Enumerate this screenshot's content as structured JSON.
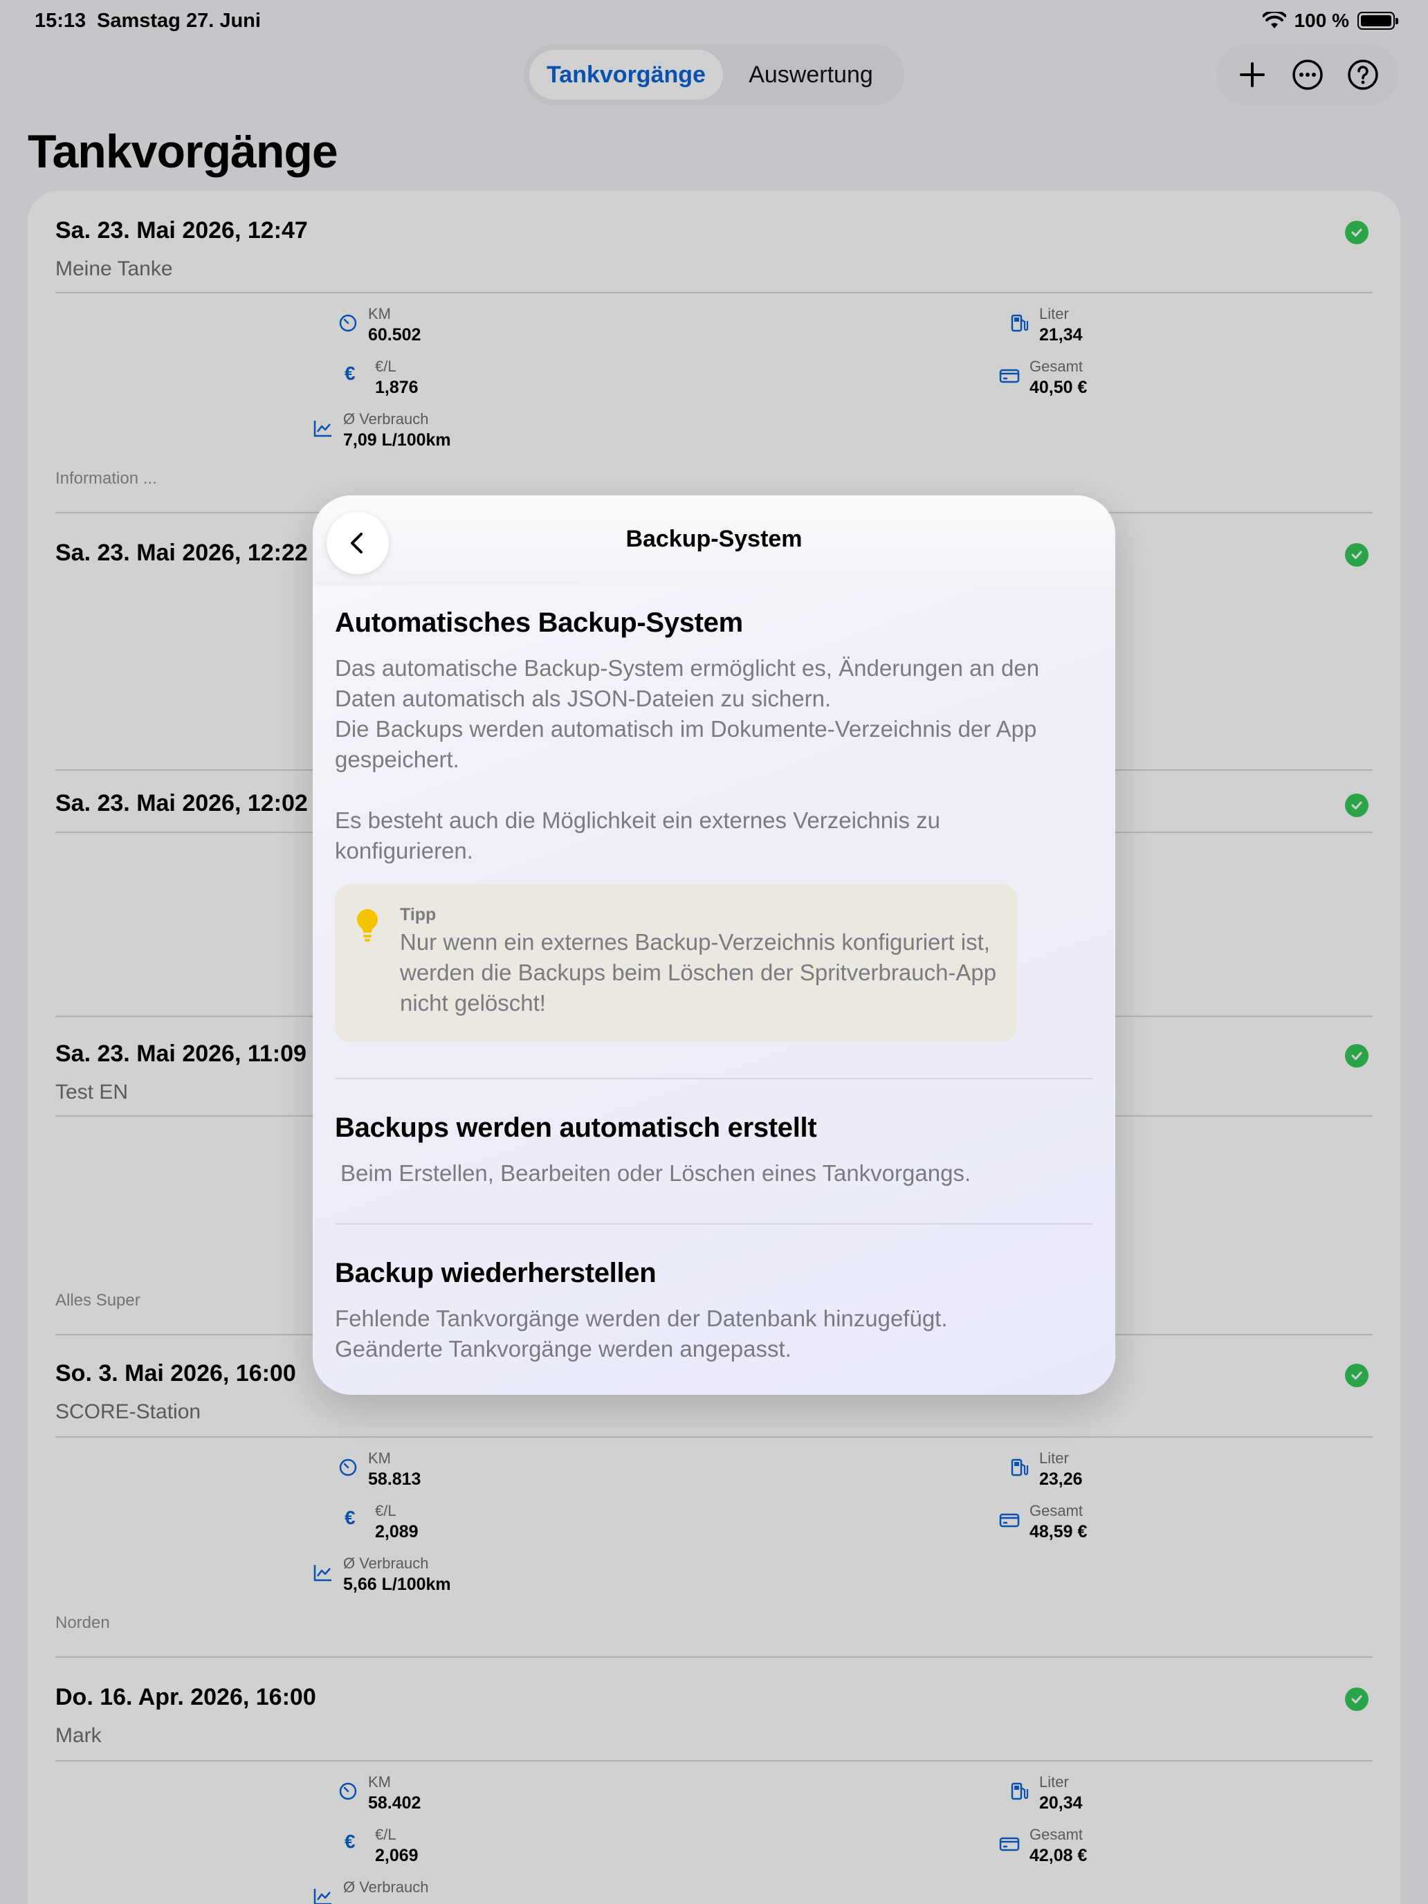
{
  "status_bar": {
    "time": "15:13",
    "date": "Samstag 27. Juni",
    "battery": "100 %"
  },
  "segments": {
    "active": "Tankvorgänge",
    "inactive": "Auswertung"
  },
  "toolbar": {
    "add": "plus-icon",
    "more": "ellipsis-icon",
    "help": "question-icon"
  },
  "page_title": "Tankvorgänge",
  "labels": {
    "km": "KM",
    "price": "€/L",
    "consumption": "Ø Verbrauch",
    "liter": "Liter",
    "total": "Gesamt"
  },
  "entries": [
    {
      "title": "Sa. 23. Mai 2026, 12:47",
      "subtitle": "Meine Tanke",
      "km": "60.502",
      "price": "1,876",
      "consumption": "7,09 L/100km",
      "liter": "21,34",
      "total": "40,50 €",
      "note": "Information ..."
    },
    {
      "title": "Sa. 23. Mai 2026, 12:22"
    },
    {
      "title": "Sa. 23. Mai 2026, 12:02"
    },
    {
      "title": "Sa. 23. Mai 2026, 11:09",
      "subtitle": "Test EN",
      "note": "Alles Super"
    },
    {
      "title": "So. 3. Mai 2026, 16:00",
      "subtitle": "SCORE-Station",
      "km": "58.813",
      "price": "2,089",
      "consumption": "5,66 L/100km",
      "liter": "23,26",
      "total": "48,59 €",
      "note": "Norden"
    },
    {
      "title": "Do. 16. Apr. 2026, 16:00",
      "subtitle": "Mark",
      "km": "58.402",
      "price": "2,069",
      "consumption": "",
      "liter": "20,34",
      "total": "42,08 €"
    }
  ],
  "modal": {
    "title": "Backup-System",
    "section1": {
      "heading": "Automatisches Backup-System",
      "p1": "Das automatische Backup-System ermöglicht es, Änderungen an den Daten automatisch als JSON-Dateien zu sichern.",
      "p2": "Die Backups werden automatisch im Dokumente-Verzeichnis der App gespeichert.",
      "p3": "Es besteht auch die Möglichkeit ein externes Verzeichnis zu konfigurieren."
    },
    "tip": {
      "label": "Tipp",
      "text": "Nur wenn ein externes Backup-Verzeichnis konfiguriert ist, werden die Backups beim Löschen der Spritverbrauch-App nicht gelöscht!"
    },
    "section2": {
      "heading": "Backups werden automatisch erstellt",
      "text": "Beim Erstellen, Bearbeiten oder Löschen eines Tankvorgangs."
    },
    "section3": {
      "heading": "Backup wiederherstellen",
      "text1": "Fehlende Tankvorgänge werden der Datenbank hinzugefügt.",
      "text2": "Geänderte Tankvorgänge werden angepasst."
    }
  },
  "colors": {
    "accent": "#0a63d6",
    "check": "#34c759",
    "bulb": "#f5c400"
  }
}
